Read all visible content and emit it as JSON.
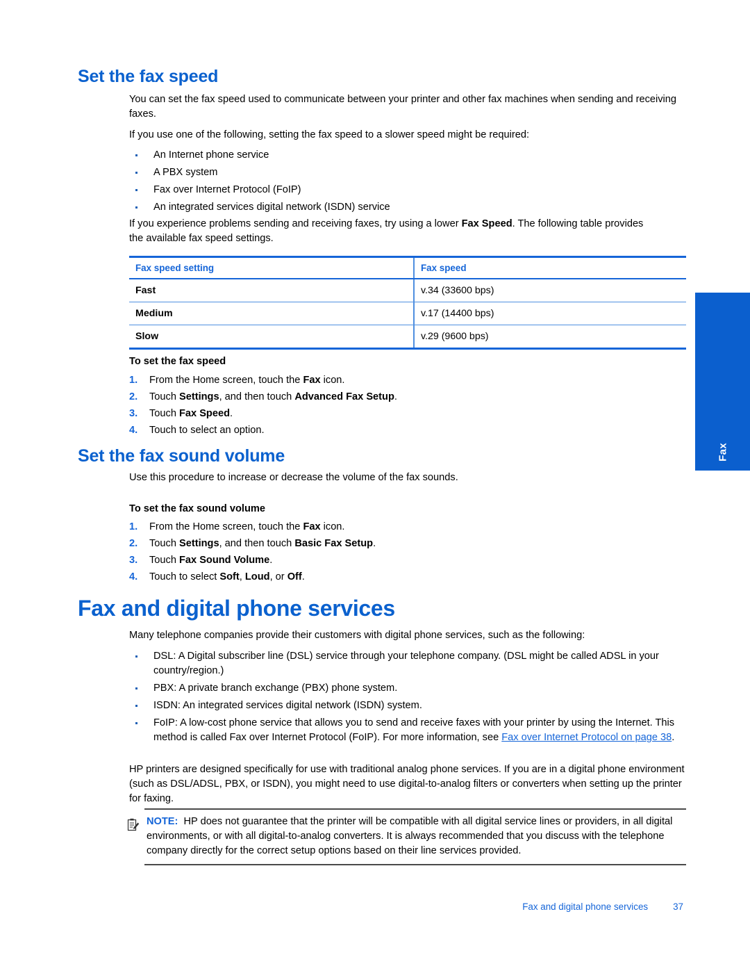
{
  "sidetab": {
    "label": "Fax",
    "color": "#0B5FCE"
  },
  "section1": {
    "heading": "Set the fax speed",
    "para1": "You can set the fax speed used to communicate between your printer and other fax machines when sending and receiving faxes.",
    "para2": "If you use one of the following, setting the fax speed to a slower speed might be required:",
    "bullets": [
      "An Internet phone service",
      "A PBX system",
      "Fax over Internet Protocol (FoIP)",
      "An integrated services digital network (ISDN) service"
    ],
    "para3_a": "If you experience problems sending and receiving faxes, try using a lower ",
    "para3_bold": "Fax Speed",
    "para3_b": ". The following table provides the available fax speed settings.",
    "table": {
      "headers": [
        "Fax speed setting",
        "Fax speed"
      ],
      "rows": [
        [
          "Fast",
          "v.34 (33600 bps)"
        ],
        [
          "Medium",
          "v.17 (14400 bps)"
        ],
        [
          "Slow",
          "v.29 (9600 bps)"
        ]
      ]
    },
    "proc_heading": "To set the fax speed",
    "steps": [
      {
        "a": "From the Home screen, touch the ",
        "b1": "Fax",
        "c": " icon."
      },
      {
        "a": "Touch ",
        "b1": "Settings",
        "c": ", and then touch ",
        "b2": "Advanced Fax Setup",
        "d": "."
      },
      {
        "a": "Touch ",
        "b1": "Fax Speed",
        "c": "."
      },
      {
        "a": "Touch to select an option."
      }
    ]
  },
  "section2": {
    "heading": "Set the fax sound volume",
    "para1": "Use this procedure to increase or decrease the volume of the fax sounds.",
    "proc_heading": "To set the fax sound volume",
    "steps": [
      {
        "a": "From the Home screen, touch the ",
        "b1": "Fax",
        "c": " icon."
      },
      {
        "a": "Touch ",
        "b1": "Settings",
        "c": ", and then touch ",
        "b2": "Basic Fax Setup",
        "d": "."
      },
      {
        "a": "Touch ",
        "b1": "Fax Sound Volume",
        "c": "."
      },
      {
        "a": "Touch to select ",
        "b1": "Soft",
        "c": ", ",
        "b2": "Loud",
        "d": ", or ",
        "b3": "Off",
        "e": "."
      }
    ]
  },
  "section3": {
    "heading": "Fax and digital phone services",
    "para1": "Many telephone companies provide their customers with digital phone services, such as the following:",
    "bullets": [
      "DSL: A Digital subscriber line (DSL) service through your telephone company. (DSL might be called ADSL in your country/region.)",
      "PBX: A private branch exchange (PBX) phone system.",
      "ISDN: An integrated services digital network (ISDN) system."
    ],
    "bullet4_a": "FoIP: A low-cost phone service that allows you to send and receive faxes with your printer by using the Internet. This method is called Fax over Internet Protocol (FoIP). For more information, see ",
    "bullet4_link": "Fax over Internet Protocol on page 38",
    "bullet4_b": ".",
    "para2": "HP printers are designed specifically for use with traditional analog phone services. If you are in a digital phone environment (such as DSL/ADSL, PBX, or ISDN), you might need to use digital-to-analog filters or converters when setting up the printer for faxing.",
    "note_label": "NOTE:",
    "note_text": "HP does not guarantee that the printer will be compatible with all digital service lines or providers, in all digital environments, or with all digital-to-analog converters. It is always recommended that you discuss with the telephone company directly for the correct setup options based on their line services provided."
  },
  "footer": {
    "title": "Fax and digital phone services",
    "page": "37"
  }
}
